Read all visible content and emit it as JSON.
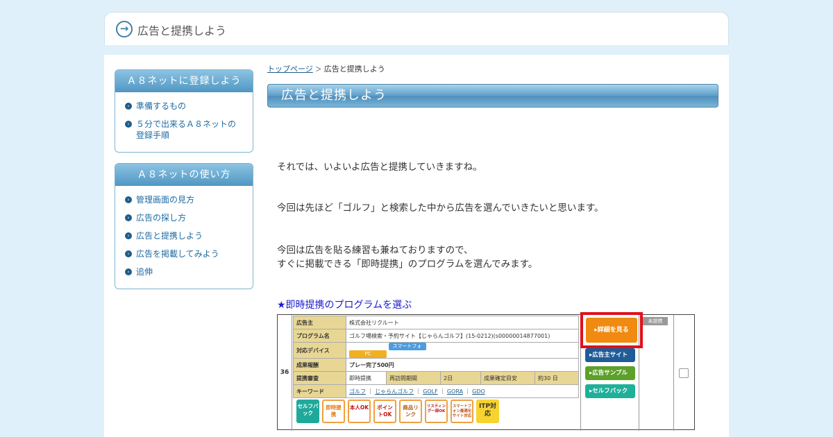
{
  "header": {
    "title": "広告と提携しよう"
  },
  "sidebar": [
    {
      "heading": "Ａ８ネットに登録しよう",
      "items": [
        {
          "label": "準備するもの"
        },
        {
          "label": "５分で出来るＡ８ネットの登録手順"
        }
      ]
    },
    {
      "heading": "Ａ８ネットの使い方",
      "items": [
        {
          "label": "管理画面の見方"
        },
        {
          "label": "広告の探し方"
        },
        {
          "label": "広告と提携しよう"
        },
        {
          "label": "広告を掲載してみよう"
        },
        {
          "label": "追伸"
        }
      ]
    }
  ],
  "breadcrumb": {
    "home": "トップページ",
    "separator": "＞",
    "current": "広告と提携しよう"
  },
  "page_title": "広告と提携しよう",
  "paragraphs": [
    "それでは、いよいよ広告と提携していきますね。",
    "今回は先ほど「ゴルフ」と検索した中から広告を選んでいきたいと思います。",
    "今回は広告を貼る練習も兼ねておりますので、",
    "すぐに掲載できる「即時提携」のプログラムを選んでみます。"
  ],
  "section_heading": "★即時提携のプログラムを選ぶ",
  "program": {
    "row_number": "36",
    "advertiser_label": "広告主",
    "advertiser": "株式会社リクルート",
    "program_label": "プログラム名",
    "program_name": "ゴルフ場検索・予約サイト【じゃらんゴルフ】(15-0212)(s00000014877001)",
    "device_label": "対応デバイス",
    "device_pc": "PC",
    "device_sp": "スマートフォン",
    "reward_label": "成果報酬",
    "reward": "プレー完了500円",
    "review_label": "提携審査",
    "review": "即時提携",
    "revisit_label": "再訪問期間",
    "revisit": "2日",
    "confirm_label": "成果確定目安",
    "confirm": "約30 日",
    "keyword_label": "キーワード",
    "keywords": [
      "ゴルフ",
      "じゃらんゴルフ",
      "GOLF",
      "GORA",
      "GDO"
    ],
    "badges": [
      "セルフバック",
      "即時提携",
      "本人OK",
      "ポイントOK",
      "商品リンク",
      "リスティング一部OK",
      "スマートフォン最適化サイト対応",
      "ITP対応"
    ],
    "buttons": {
      "detail": "▸詳細を見る",
      "advertiser_site": "▸広告主サイト",
      "ad_sample": "▸広告サンプル",
      "selfback": "▸セルフバック"
    },
    "status": "未提携"
  }
}
